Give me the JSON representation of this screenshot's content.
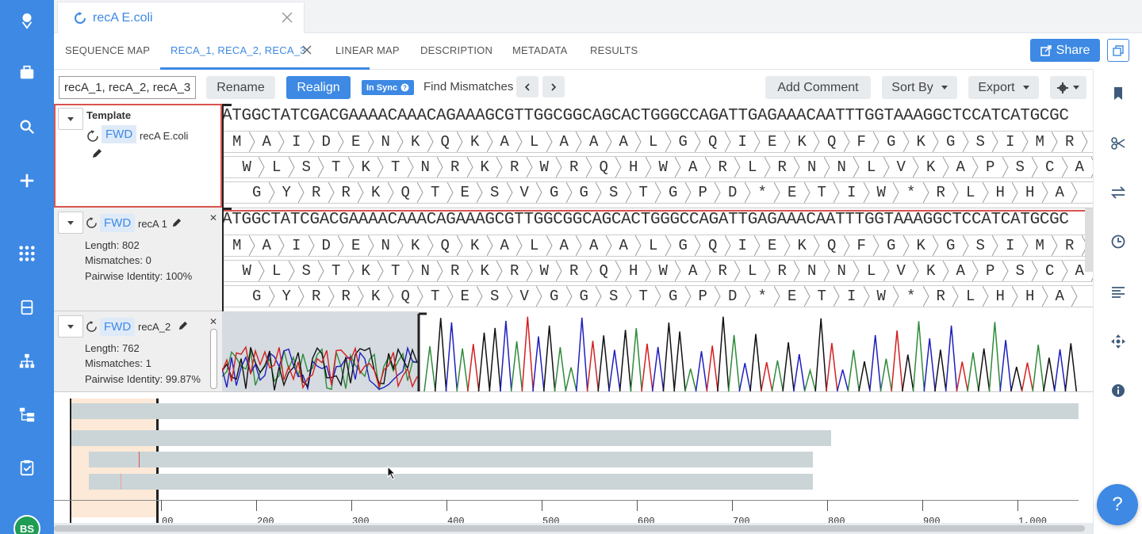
{
  "file_tab": {
    "title": "recA E.coli"
  },
  "view_tabs": {
    "sequence_map": "SEQUENCE MAP",
    "alignment": "RECA_1, RECA_2, RECA_3",
    "linear_map": "LINEAR MAP",
    "description": "DESCRIPTION",
    "metadata": "METADATA",
    "results": "RESULTS"
  },
  "share_label": "Share",
  "toolbar": {
    "name_value": "recA_1, recA_2, recA_3",
    "rename": "Rename",
    "realign": "Realign",
    "in_sync": "In Sync",
    "find_mismatches": "Find Mismatches",
    "add_comment": "Add Comment",
    "sort_by": "Sort By",
    "export": "Export"
  },
  "template": {
    "heading": "Template",
    "direction": "FWD",
    "name": "recA E.coli"
  },
  "tracks": [
    {
      "direction": "FWD",
      "name": "recA 1",
      "length": "Length: 802",
      "mismatches": "Mismatches: 0",
      "identity": "Pairwise Identity: 100%"
    },
    {
      "direction": "FWD",
      "name": "recA_2",
      "length": "Length: 762",
      "mismatches": "Mismatches: 1",
      "identity": "Pairwise Identity: 99.87%"
    }
  ],
  "dna": "ATGGCTATCGACGAAAACAAACAGAAAGCGTTGGCGGCAGCACTGGGCCAGATTGAGAAACAATTTGGTAAAGGCTCCATCATGCGC",
  "frame1": [
    "M",
    "A",
    "I",
    "D",
    "E",
    "N",
    "K",
    "Q",
    "K",
    "A",
    "L",
    "A",
    "A",
    "A",
    "L",
    "G",
    "Q",
    "I",
    "E",
    "K",
    "Q",
    "F",
    "G",
    "K",
    "G",
    "S",
    "I",
    "M",
    "R"
  ],
  "frame2": [
    "W",
    "L",
    "S",
    "T",
    "K",
    "T",
    "N",
    "R",
    "K",
    "R",
    "W",
    "R",
    "Q",
    "H",
    "W",
    "A",
    "R",
    "L",
    "R",
    "N",
    "N",
    "L",
    "V",
    "K",
    "A",
    "P",
    "S",
    "C",
    "A"
  ],
  "frame3": [
    "G",
    "Y",
    "R",
    "R",
    "K",
    "Q",
    "T",
    "E",
    "S",
    "V",
    "G",
    "G",
    "S",
    "T",
    "G",
    "P",
    "D",
    "*",
    "E",
    "T",
    "I",
    "W",
    "*",
    "R",
    "L",
    "H",
    "H",
    "A"
  ],
  "overview_ticks": [
    "00",
    "200",
    "300",
    "400",
    "500",
    "600",
    "700",
    "800",
    "900",
    "1,000"
  ],
  "icons": {
    "nav": [
      "logo-icon",
      "briefcase-icon",
      "search-icon",
      "plus-icon",
      "apps-grid-icon",
      "database-icon",
      "hierarchy-icon",
      "workflow-icon",
      "clipboard-check-icon"
    ],
    "right": [
      "bookmark-icon",
      "scissors-icon",
      "swap-icon",
      "history-icon",
      "align-left-icon",
      "move-icon",
      "info-icon"
    ]
  },
  "avatar": "BS",
  "colors": {
    "accent": "#3d89e4",
    "template_border": "#d9534f",
    "chrom_a": "#2e8b3a",
    "chrom_c": "#1f1fbf",
    "chrom_g": "#111111",
    "chrom_t": "#d42020"
  }
}
